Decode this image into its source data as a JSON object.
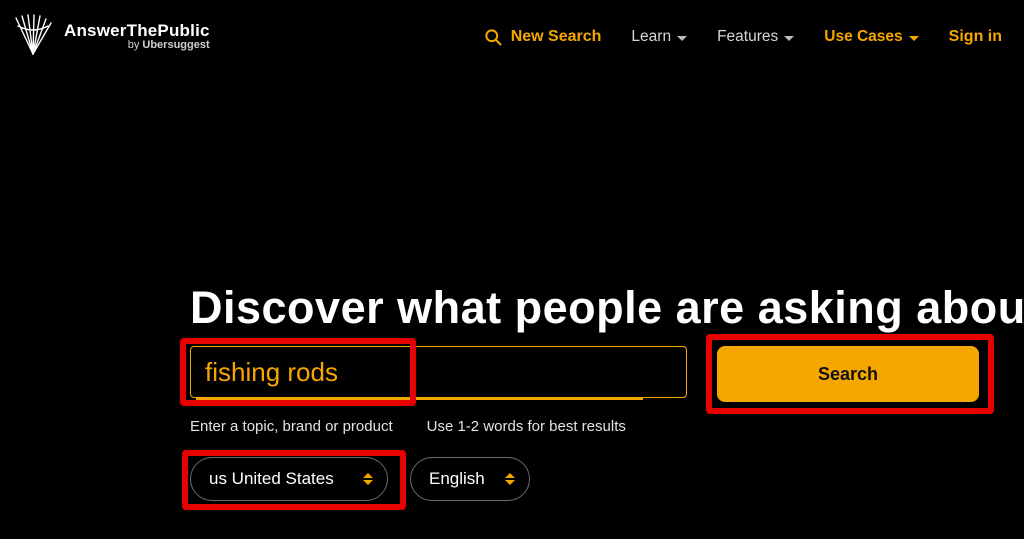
{
  "brand": {
    "title": "AnswerThePublic",
    "byline_prefix": "by ",
    "byline_brand": "Ubersuggest"
  },
  "nav": {
    "new_search": "New Search",
    "learn": "Learn",
    "features": "Features",
    "use_cases": "Use Cases",
    "sign_in": "Sign in"
  },
  "hero": {
    "headline": "Discover what people are asking about…"
  },
  "search": {
    "value": "fishing rods",
    "hint_left": "Enter a topic, brand or product",
    "hint_right": "Use 1-2 words for best results",
    "button": "Search"
  },
  "filters": {
    "country": "us United States",
    "language": "English"
  },
  "colors": {
    "accent": "#f5a700",
    "highlight": "#e60000",
    "bg": "#000000"
  }
}
